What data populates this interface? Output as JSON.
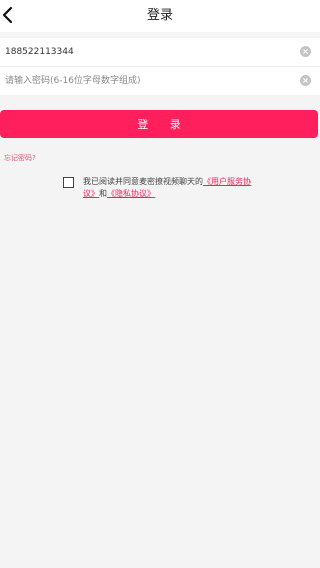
{
  "header": {
    "title": "登录",
    "back_icon": "back-arrow-icon"
  },
  "form": {
    "phone_value": "188522113344",
    "password_value": "",
    "password_placeholder": "请输入密码(6-16位字母数字组成)",
    "clear_icon": "clear-circle-icon"
  },
  "login_button": {
    "label": "登 录"
  },
  "forgot_password": {
    "label": "忘记密码?"
  },
  "agreement": {
    "checked": false,
    "prefix": "我已阅读并同意麦密撩视频聊天的",
    "user_agreement": "《用户服务协议》",
    "connector": "和",
    "privacy_policy": "《隐私协议》"
  },
  "colors": {
    "accent": "#ff1f5d",
    "link_muted": "#e05a7a",
    "background": "#f4f4f4"
  }
}
